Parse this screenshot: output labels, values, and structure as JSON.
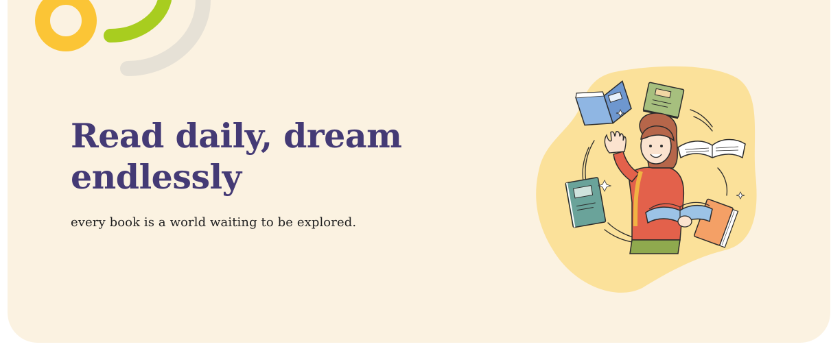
{
  "hero": {
    "headline": "Read daily, dream endlessly",
    "tagline": "every book is a world waiting to be explored."
  },
  "colors": {
    "background": "#fbf2e1",
    "headline": "#443a75",
    "accent_yellow": "#fbc536",
    "accent_green": "#a8cd1f",
    "accent_grey": "#e6e1d6",
    "blob": "#fbe19a"
  },
  "illustration": {
    "icon": "girl-with-flying-books-illustration"
  }
}
